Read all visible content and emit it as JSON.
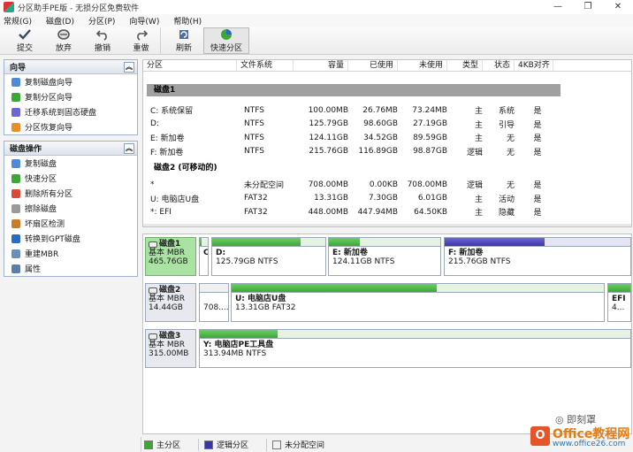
{
  "window": {
    "title": "分区助手PE版 - 无损分区免费软件",
    "minimize": "—",
    "restore": "❐",
    "close": "✕"
  },
  "menu": [
    "常规(G)",
    "磁盘(D)",
    "分区(P)",
    "向导(W)",
    "帮助(H)"
  ],
  "toolbar": {
    "commit": "提交",
    "discard": "放弃",
    "undo": "撤销",
    "redo": "重做",
    "refresh": "刷新",
    "quick_partition": "快速分区"
  },
  "wizard_panel": {
    "title": "向导",
    "items": [
      "复制磁盘向导",
      "复制分区向导",
      "迁移系统到固态硬盘",
      "分区恢复向导"
    ]
  },
  "disk_ops_panel": {
    "title": "磁盘操作",
    "items": [
      "复制磁盘",
      "快速分区",
      "删除所有分区",
      "擦除磁盘",
      "坏扇区检测",
      "转换到GPT磁盘",
      "重建MBR",
      "属性"
    ]
  },
  "partition_table": {
    "headers": [
      "分区",
      "文件系统",
      "容量",
      "已使用",
      "未使用",
      "类型",
      "状态",
      "4KB对齐"
    ],
    "disk1_label": "磁盘1",
    "disk1_rows": [
      [
        "C: 系统保留",
        "NTFS",
        "100.00MB",
        "26.76MB",
        "73.24MB",
        "主",
        "系统",
        "是"
      ],
      [
        "D:",
        "NTFS",
        "125.79GB",
        "98.60GB",
        "27.19GB",
        "主",
        "引导",
        "是"
      ],
      [
        "E: 新加卷",
        "NTFS",
        "124.11GB",
        "34.52GB",
        "89.59GB",
        "主",
        "无",
        "是"
      ],
      [
        "F: 新加卷",
        "NTFS",
        "215.76GB",
        "116.89GB",
        "98.87GB",
        "逻辑",
        "无",
        "是"
      ]
    ],
    "disk2_label": "磁盘2 (可移动的)",
    "disk2_rows": [
      [
        "*",
        "未分配空间",
        "708.00MB",
        "0.00KB",
        "708.00MB",
        "逻辑",
        "无",
        "是"
      ],
      [
        "U: 电脑店U盘",
        "FAT32",
        "13.31GB",
        "7.30GB",
        "6.01GB",
        "主",
        "活动",
        "是"
      ],
      [
        "*: EFI",
        "FAT32",
        "448.00MB",
        "447.94MB",
        "64.50KB",
        "主",
        "隐藏",
        "是"
      ]
    ]
  },
  "disk_map": {
    "disk1": {
      "name": "磁盘1",
      "type": "基本 MBR",
      "size": "465.76GB",
      "parts": [
        {
          "name": "C",
          "size": "",
          "used": 0.27,
          "kind": "primary"
        },
        {
          "name": "D:",
          "size": "125.79GB NTFS",
          "used": 0.78,
          "kind": "primary"
        },
        {
          "name": "E: 新加卷",
          "size": "124.11GB NTFS",
          "used": 0.28,
          "kind": "primary"
        },
        {
          "name": "F: 新加卷",
          "size": "215.76GB NTFS",
          "used": 0.54,
          "kind": "logical"
        }
      ]
    },
    "disk2": {
      "name": "磁盘2",
      "type": "基本 MBR",
      "size": "14.44GB",
      "parts": [
        {
          "name": "",
          "size": "708....",
          "used": 0,
          "kind": "unalloc"
        },
        {
          "name": "U: 电脑店U盘",
          "size": "13.31GB FAT32",
          "used": 0.55,
          "kind": "primary"
        },
        {
          "name": "EFI",
          "size": "4...",
          "used": 1.0,
          "kind": "primary"
        }
      ]
    },
    "disk3": {
      "name": "磁盘3",
      "type": "基本 MBR",
      "size": "315.00MB",
      "parts": [
        {
          "name": "Y: 电脑店PE工具盘",
          "size": "313.94MB NTFS",
          "used": 0.18,
          "kind": "primary"
        }
      ]
    }
  },
  "legend": {
    "primary": "主分区",
    "logical": "逻辑分区",
    "unallocated": "未分配空间"
  },
  "colors": {
    "primary": "#3da735",
    "logical": "#3c35a9",
    "selected_disk": "#a9e2a3"
  },
  "watermark": {
    "follow": "◎ 即刻罩",
    "brand": "Office教程网",
    "url": "www.office26.com",
    "logo": "O"
  }
}
